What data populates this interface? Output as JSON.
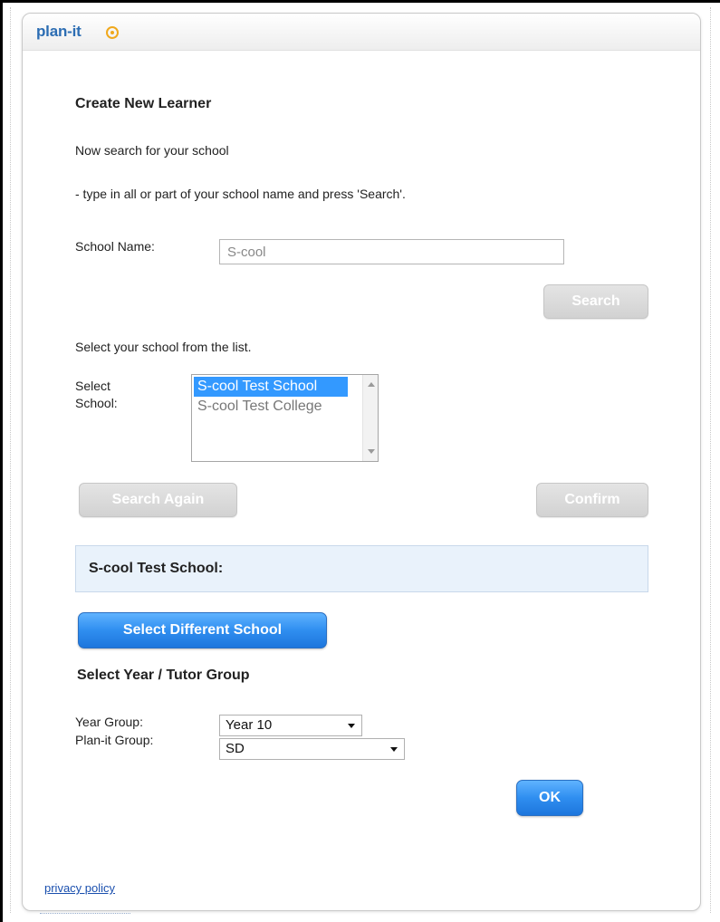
{
  "header": {
    "logo_text": "plan-it"
  },
  "form": {
    "title": "Create New Learner",
    "instruction_1": "Now search for your school",
    "instruction_2": "- type in all or part of your school name and press 'Search'.",
    "school_name_label": "School Name:",
    "school_name_value": "S-cool",
    "search_button": "Search",
    "select_instruction": "Select your school from the list.",
    "select_school_label": "Select School:",
    "schools": [
      {
        "name": "S-cool Test School",
        "selected": true
      },
      {
        "name": "S-cool Test College",
        "selected": false
      }
    ],
    "search_again_button": "Search Again",
    "confirm_button": "Confirm",
    "selected_school_heading": "S-cool Test School:",
    "select_different_button": "Select Different School",
    "group_title": "Select Year / Tutor Group",
    "year_group_label": "Year Group:",
    "year_group_value": "Year 10",
    "planit_group_label": "Plan-it Group:",
    "planit_group_value": "SD",
    "ok_button": "OK"
  },
  "footer": {
    "privacy_link": "privacy policy"
  },
  "colors": {
    "accent_blue": "#2f8ef0",
    "logo_blue": "#2c6db3",
    "logo_orange": "#f0a81c",
    "selection_blue": "#3399ff",
    "panel_bg": "#e9f2fb"
  }
}
